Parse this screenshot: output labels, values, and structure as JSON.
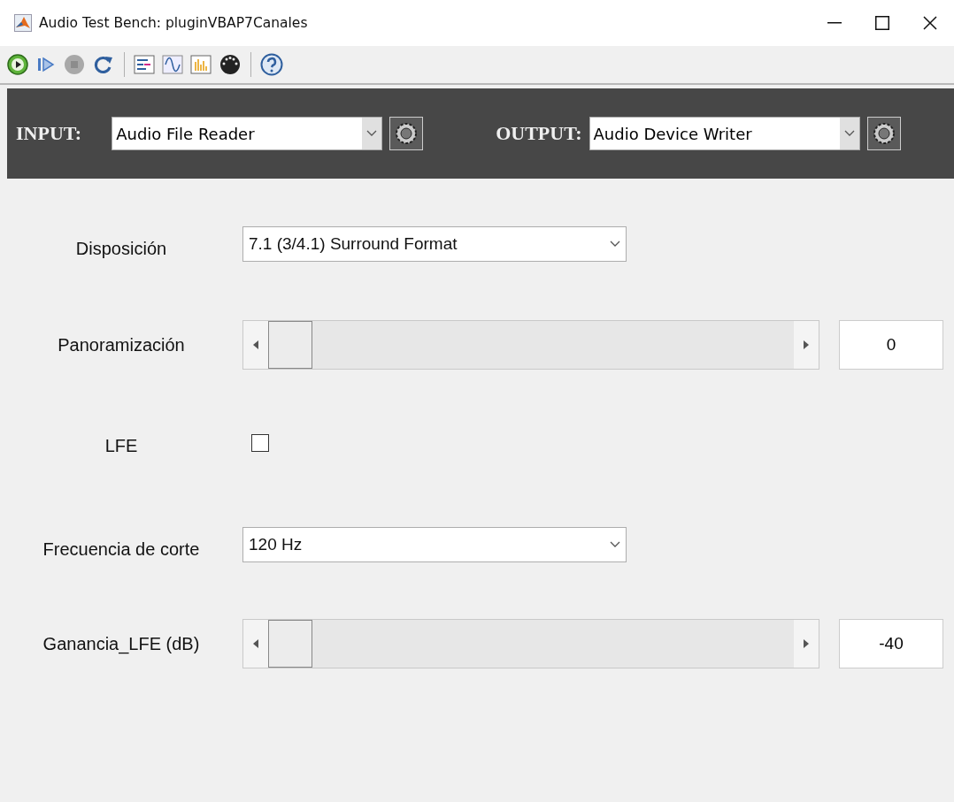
{
  "window": {
    "title": "Audio Test Bench: pluginVBAP7Canales"
  },
  "io_bar": {
    "input_label": "INPUT:",
    "input_value": "Audio File Reader",
    "output_label": "OUTPUT:",
    "output_value": "Audio Device Writer"
  },
  "parameters": [
    {
      "kind": "dropdown",
      "label": "Disposición",
      "value": "7.1 (3/4.1) Surround Format"
    },
    {
      "kind": "slider",
      "label": "Panoramización",
      "level": 0,
      "reading": "0"
    },
    {
      "kind": "checkbox",
      "label": "LFE",
      "checked": false
    },
    {
      "kind": "dropdown",
      "label": "Frecuencia de corte",
      "value": "120 Hz"
    },
    {
      "kind": "slider",
      "label": "Ganancia_LFE (dB)",
      "level": 0,
      "reading": "-40"
    }
  ]
}
